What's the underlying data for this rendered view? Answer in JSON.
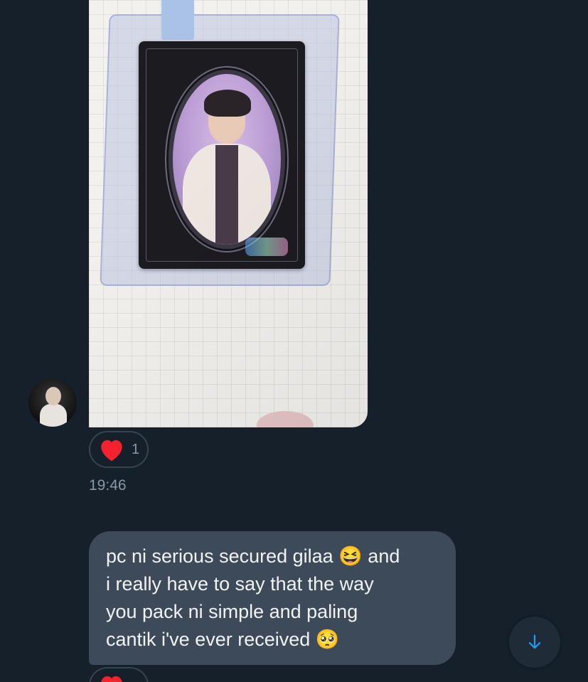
{
  "conversation": {
    "messages": [
      {
        "type": "image",
        "description_icon": "photo-attachment",
        "reaction": {
          "emoji_icon": "heart-icon",
          "count": "1"
        },
        "time": "19:46"
      },
      {
        "type": "text",
        "lines": [
          "pc ni serious secured gilaa 😆 and",
          "i really have to say that the way",
          "you pack ni simple and paling",
          "cantik i've ever received 🥺"
        ]
      }
    ]
  },
  "colors": {
    "background": "#15202b",
    "bubble": "#3d4a59",
    "heart": "#f4212e",
    "accent": "#1d9bf0",
    "muted_text": "#8b98a5"
  },
  "icons": {
    "scroll_down": "arrow-down-icon",
    "reaction": "heart-icon"
  }
}
